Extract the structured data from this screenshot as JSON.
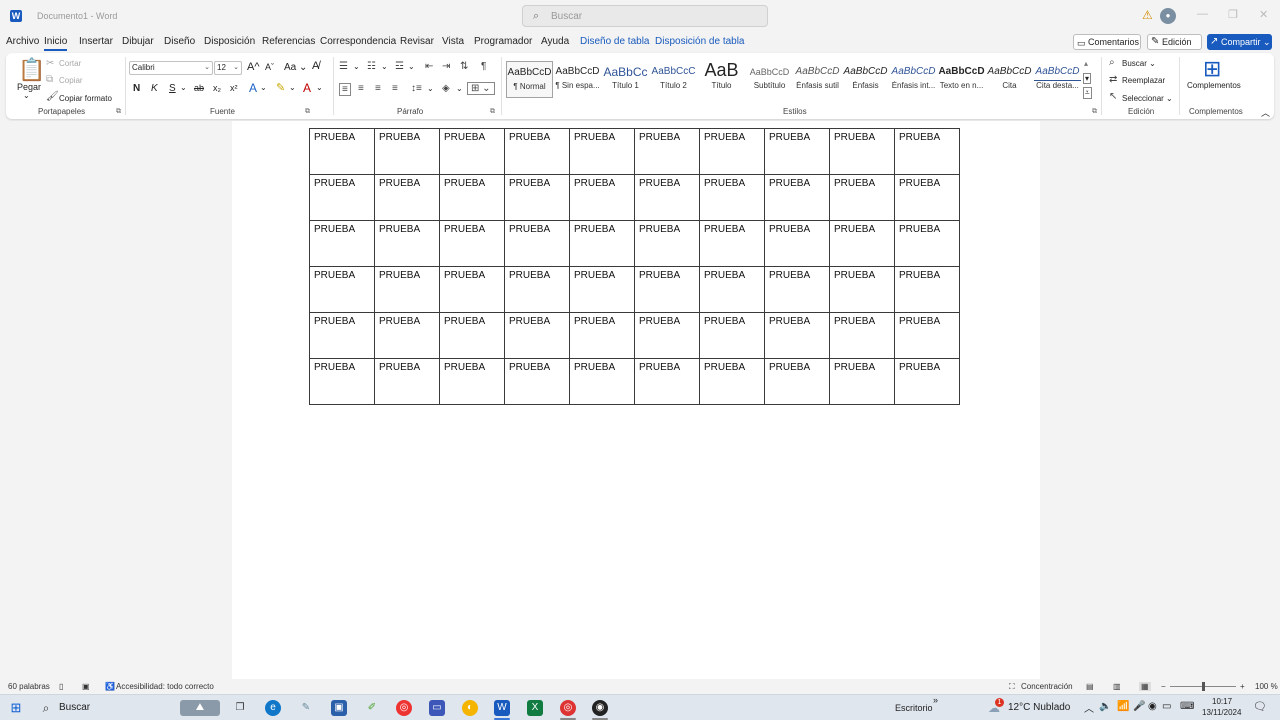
{
  "window": {
    "title": "Documento1 - Word",
    "search_placeholder": "Buscar"
  },
  "menu": {
    "tabs": [
      "Archivo",
      "Inicio",
      "Insertar",
      "Dibujar",
      "Diseño",
      "Disposición",
      "Referencias",
      "Correspondencia",
      "Revisar",
      "Vista",
      "Programador",
      "Ayuda"
    ],
    "context_tabs": [
      "Diseño de tabla",
      "Disposición de tabla"
    ],
    "active_tab": "Inicio",
    "comments_label": "Comentarios",
    "editing_label": "Edición",
    "share_label": "Compartir"
  },
  "ribbon": {
    "clipboard": {
      "paste": "Pegar",
      "cut": "Cortar",
      "copy": "Copiar",
      "format_painter": "Copiar formato",
      "label": "Portapapeles"
    },
    "font": {
      "name": "Calibri",
      "size": "12",
      "label": "Fuente",
      "bold": "N",
      "italic": "K",
      "underline": "S",
      "strike": "ab",
      "sub": "x₂",
      "sup": "x²",
      "case": "Aa",
      "grow": "A",
      "shrink": "A"
    },
    "paragraph": {
      "label": "Párrafo"
    },
    "styles": {
      "label": "Estilos",
      "items": [
        {
          "preview": "AaBbCcD",
          "name": "¶ Normal"
        },
        {
          "preview": "AaBbCcD",
          "name": "¶ Sin espa..."
        },
        {
          "preview": "AaBbCc",
          "name": "Título 1"
        },
        {
          "preview": "AaBbCcC",
          "name": "Título 2"
        },
        {
          "preview": "AaB",
          "name": "Título"
        },
        {
          "preview": "AaBbCcD",
          "name": "Subtítulo"
        },
        {
          "preview": "AaBbCcD",
          "name": "Énfasis sutil"
        },
        {
          "preview": "AaBbCcD",
          "name": "Énfasis"
        },
        {
          "preview": "AaBbCcD",
          "name": "Énfasis int..."
        },
        {
          "preview": "AaBbCcD",
          "name": "Texto en n..."
        },
        {
          "preview": "AaBbCcD",
          "name": "Cita"
        },
        {
          "preview": "AaBbCcD",
          "name": "Cita desta..."
        }
      ]
    },
    "editing": {
      "find": "Buscar",
      "replace": "Reemplazar",
      "select": "Seleccionar",
      "label": "Edición"
    },
    "addins": {
      "button": "Complementos",
      "label": "Complementos"
    }
  },
  "document": {
    "table": [
      [
        "PRUEBA",
        "PRUEBA",
        "PRUEBA",
        "PRUEBA",
        "PRUEBA",
        "PRUEBA",
        "PRUEBA",
        "PRUEBA",
        "PRUEBA",
        "PRUEBA"
      ],
      [
        "PRUEBA",
        "PRUEBA",
        "PRUEBA",
        "PRUEBA",
        "PRUEBA",
        "PRUEBA",
        "PRUEBA",
        "PRUEBA",
        "PRUEBA",
        "PRUEBA"
      ],
      [
        "PRUEBA",
        "PRUEBA",
        "PRUEBA",
        "PRUEBA",
        "PRUEBA",
        "PRUEBA",
        "PRUEBA",
        "PRUEBA",
        "PRUEBA",
        "PRUEBA"
      ],
      [
        "PRUEBA",
        "PRUEBA",
        "PRUEBA",
        "PRUEBA",
        "PRUEBA",
        "PRUEBA",
        "PRUEBA",
        "PRUEBA",
        "PRUEBA",
        "PRUEBA"
      ],
      [
        "PRUEBA",
        "PRUEBA",
        "PRUEBA",
        "PRUEBA",
        "PRUEBA",
        "PRUEBA",
        "PRUEBA",
        "PRUEBA",
        "PRUEBA",
        "PRUEBA"
      ],
      [
        "PRUEBA",
        "PRUEBA",
        "PRUEBA",
        "PRUEBA",
        "PRUEBA",
        "PRUEBA",
        "PRUEBA",
        "PRUEBA",
        "PRUEBA",
        "PRUEBA"
      ]
    ]
  },
  "status": {
    "words": "60 palabras",
    "accessibility": "Accesibilidad: todo correcto",
    "focus": "Concentración",
    "zoom": "100 %"
  },
  "taskbar": {
    "search": "Buscar",
    "desktop": "Escritorio",
    "weather": "12°C  Nublado",
    "time": "10:17",
    "date": "13/11/2024",
    "notif_badge": "1"
  }
}
